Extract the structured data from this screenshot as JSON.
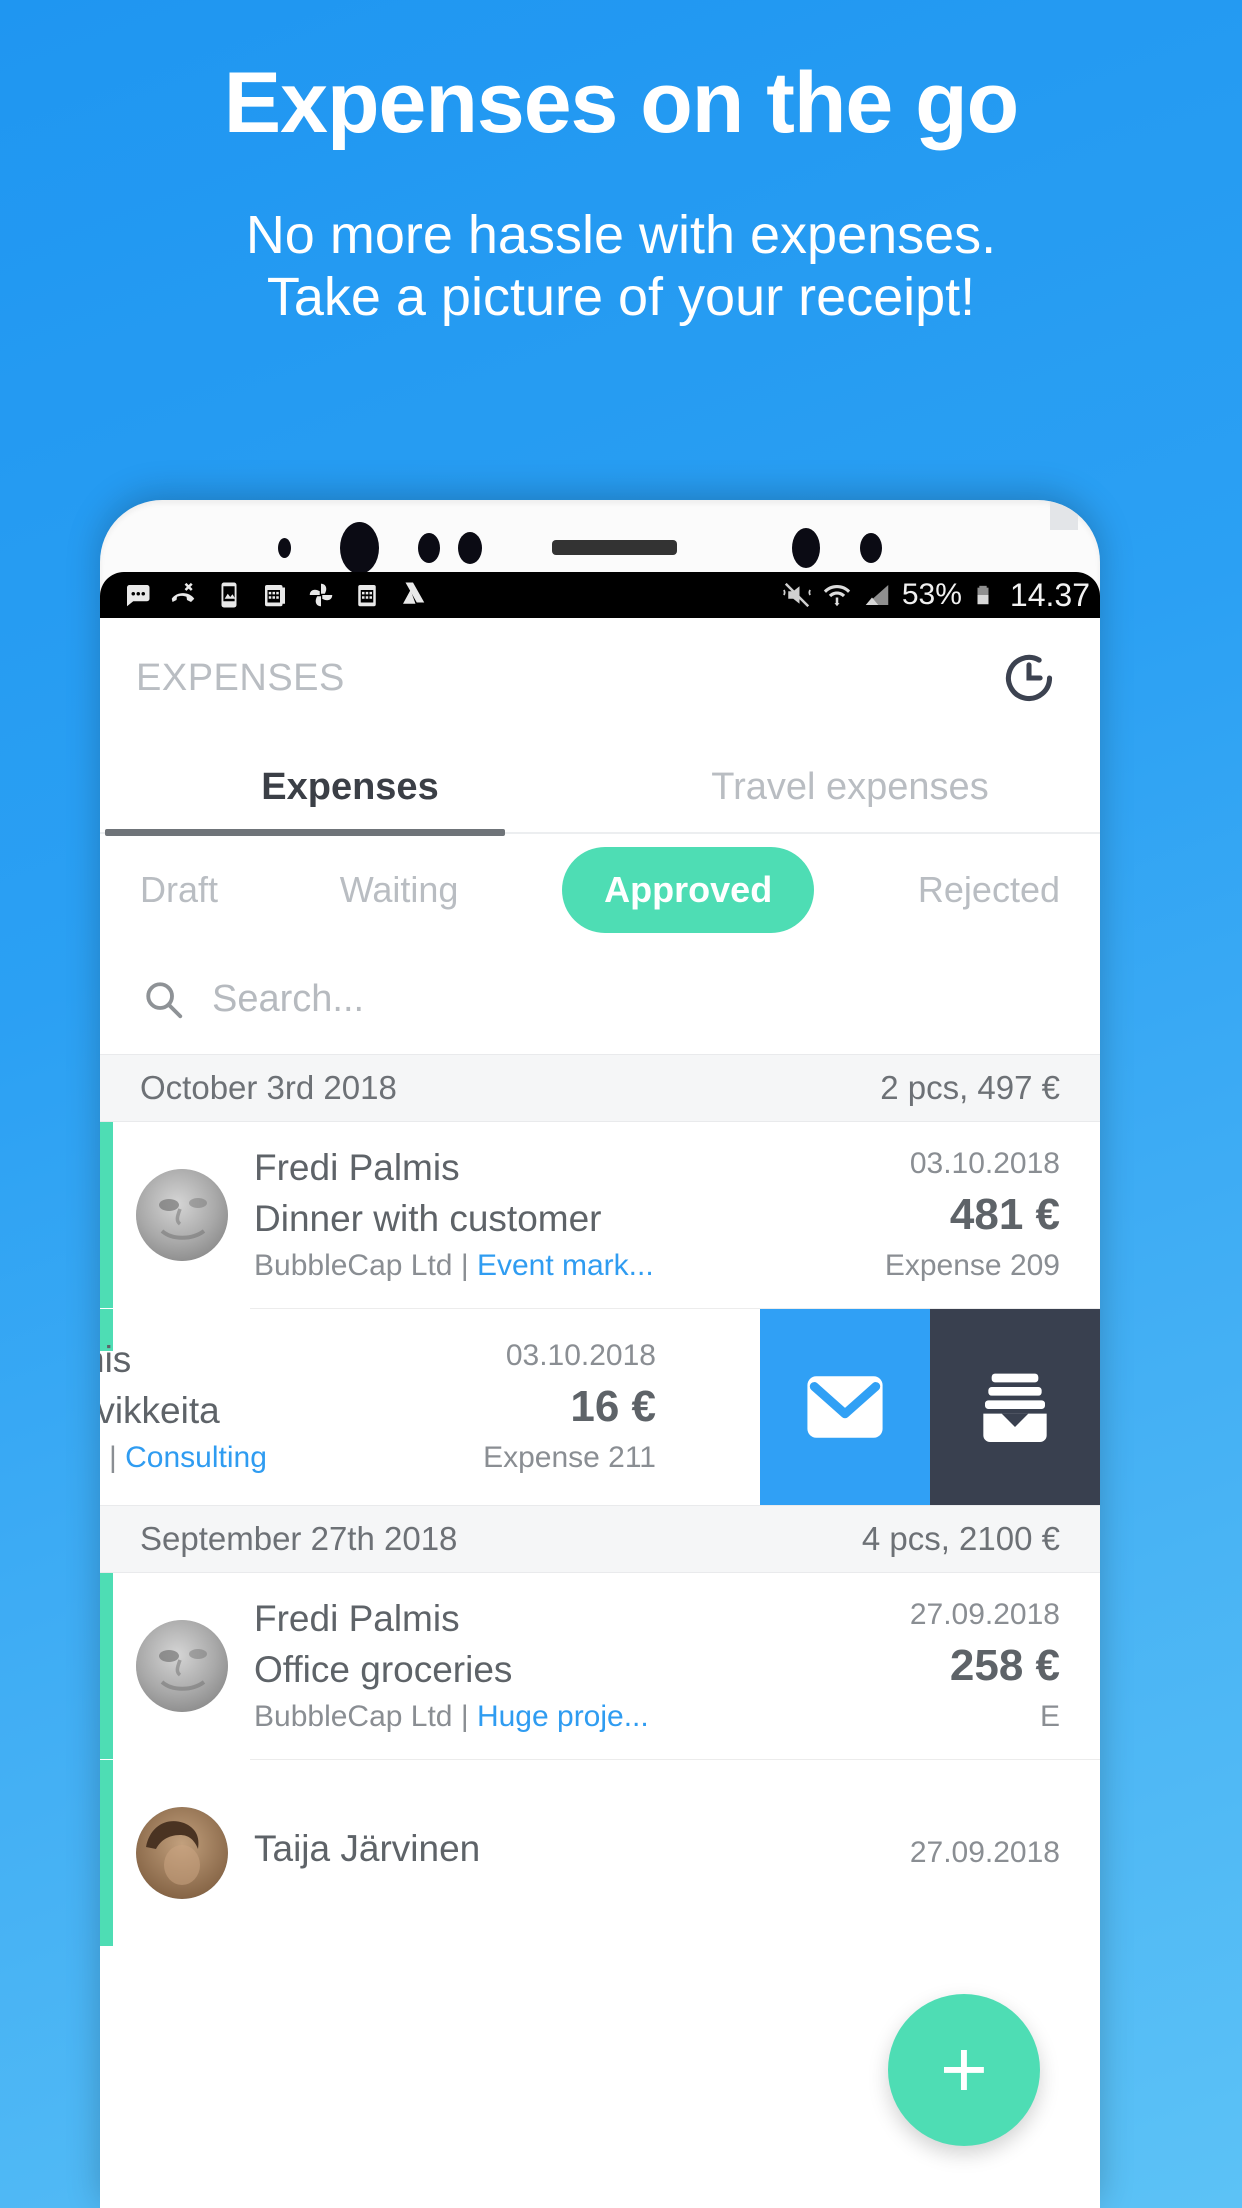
{
  "promo": {
    "title": "Expenses on the go",
    "subtitle_line1": "No more hassle with expenses.",
    "subtitle_line2": "Take a picture of your receipt!"
  },
  "theme": {
    "background_top": "#1f96f1",
    "background_bottom": "#5cc2f6",
    "accent_green": "#4eddb4",
    "link_blue": "#2f9cf1",
    "action_mail_blue": "#30a0f5",
    "action_archive_navy": "#39404f"
  },
  "status_bar": {
    "icons": [
      "messages-icon",
      "missed-call-icon",
      "photo-icon",
      "calendar-icon",
      "photos-pinwheel-icon",
      "calendar-alt-icon",
      "drive-icon"
    ],
    "right_icons": [
      "vibrate-mute-icon",
      "wifi-icon",
      "cellular-signal-icon",
      "battery-icon"
    ],
    "battery_percent": "53%",
    "time": "14.37"
  },
  "app": {
    "title": "EXPENSES",
    "history_icon": "history-clock-icon",
    "tabs": [
      {
        "label": "Expenses",
        "active": true
      },
      {
        "label": "Travel expenses",
        "active": false
      }
    ],
    "filters": [
      {
        "label": "Draft",
        "active": false
      },
      {
        "label": "Waiting",
        "active": false
      },
      {
        "label": "Approved",
        "active": true
      },
      {
        "label": "Rejected",
        "active": false
      }
    ],
    "search": {
      "placeholder": "Search...",
      "icon": "search-icon"
    },
    "sections": [
      {
        "date": "October 3rd 2018",
        "summary": "2 pcs, 497 €",
        "rows": [
          {
            "name": "Fredi Palmis",
            "description": "Dinner with customer",
            "company": "BubbleCap Ltd | ",
            "project": "Event mark...",
            "date": "03.10.2018",
            "amount": "481 €",
            "expense_no": "Expense 209"
          }
        ],
        "swiped_row": {
          "name_partial": "nis",
          "description_partial": "rvikkeita",
          "company_partial": ".. | ",
          "project": "Consulting",
          "date": "03.10.2018",
          "amount": "16 €",
          "expense_no": "Expense 211",
          "actions": [
            {
              "name": "mail-action",
              "icon": "envelope-icon"
            },
            {
              "name": "archive-action",
              "icon": "archive-box-icon"
            }
          ]
        }
      },
      {
        "date": "September 27th 2018",
        "summary": "4 pcs, 2100 €",
        "rows": [
          {
            "name": "Fredi Palmis",
            "description": "Office groceries",
            "company": "BubbleCap Ltd | ",
            "project": "Huge proje...",
            "date": "27.09.2018",
            "amount": "258 €",
            "expense_no": "E"
          },
          {
            "name": "Taija Järvinen",
            "description": "",
            "company": "",
            "project": "",
            "date": "27.09.2018",
            "amount": "",
            "expense_no": ""
          }
        ]
      }
    ],
    "fab": {
      "label": "+",
      "icon": "plus-icon"
    }
  }
}
